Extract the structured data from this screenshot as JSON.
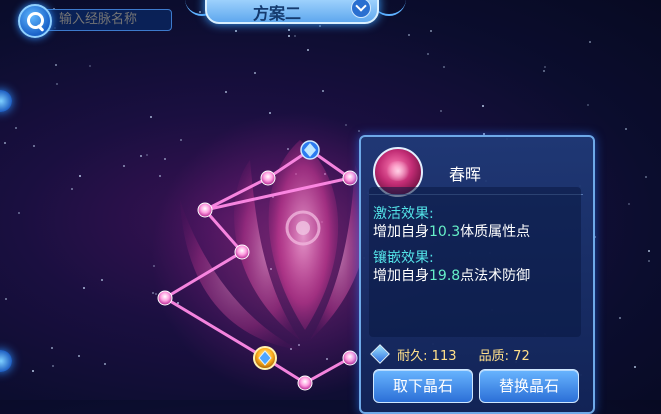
{
  "search": {
    "placeholder": "输入经脉名称"
  },
  "plan_selector": {
    "label": "方案二"
  },
  "panel": {
    "crystal_name": "春晖",
    "activate_title": "激活效果:",
    "activate_prefix": "增加自身",
    "activate_value": "10.3",
    "activate_suffix": "体质属性点",
    "inlay_title": "镶嵌效果:",
    "inlay_prefix": "增加自身",
    "inlay_value": "19.8",
    "inlay_suffix": "点法术防御",
    "durability_label": "耐久:",
    "durability_value": "113",
    "quality_label": "品质:",
    "quality_value": "72",
    "remove_button": "取下晶石",
    "replace_button": "替换晶石"
  },
  "colors": {
    "highlight_value": "#66f0c8",
    "section_title": "#53e3e8",
    "stat_text": "#ffe08a",
    "meridian_line": "#ff8ae6"
  }
}
